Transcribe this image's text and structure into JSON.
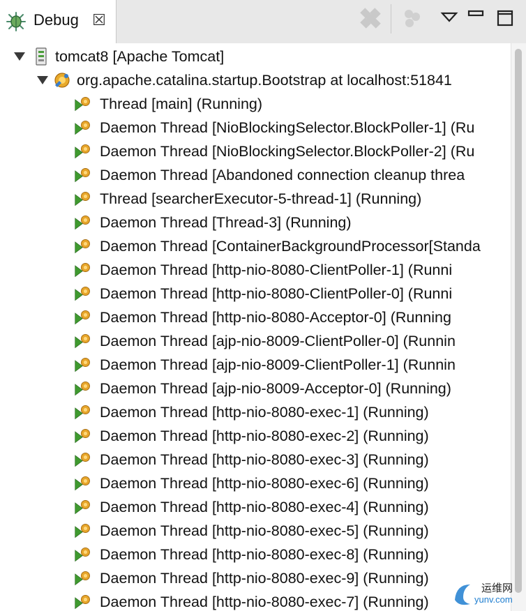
{
  "tab": {
    "label": "Debug",
    "close_glyph": "☒"
  },
  "toolbar": {
    "buttons": [
      {
        "name": "remove-all-terminated-icon"
      },
      {
        "name": "connect-icon"
      },
      {
        "name": "view-menu-icon"
      },
      {
        "name": "minimize-icon"
      },
      {
        "name": "maximize-icon"
      }
    ]
  },
  "tree": {
    "server": {
      "label": "tomcat8 [Apache Tomcat]",
      "icon": "server-icon"
    },
    "vm": {
      "label": "org.apache.catalina.startup.Bootstrap at localhost:51841",
      "icon": "debug-target-icon"
    },
    "threads": [
      "Thread [main] (Running)",
      "Daemon Thread [NioBlockingSelector.BlockPoller-1] (Ru",
      "Daemon Thread [NioBlockingSelector.BlockPoller-2] (Ru",
      "Daemon Thread [Abandoned connection cleanup threa",
      "Thread [searcherExecutor-5-thread-1] (Running)",
      "Daemon Thread [Thread-3] (Running)",
      "Daemon Thread [ContainerBackgroundProcessor[Standa",
      "Daemon Thread [http-nio-8080-ClientPoller-1] (Runni",
      "Daemon Thread [http-nio-8080-ClientPoller-0] (Runni",
      "Daemon Thread [http-nio-8080-Acceptor-0] (Running",
      "Daemon Thread [ajp-nio-8009-ClientPoller-0] (Runnin",
      "Daemon Thread [ajp-nio-8009-ClientPoller-1] (Runnin",
      "Daemon Thread [ajp-nio-8009-Acceptor-0] (Running)",
      "Daemon Thread [http-nio-8080-exec-1] (Running)",
      "Daemon Thread [http-nio-8080-exec-2] (Running)",
      "Daemon Thread [http-nio-8080-exec-3] (Running)",
      "Daemon Thread [http-nio-8080-exec-6] (Running)",
      "Daemon Thread [http-nio-8080-exec-4] (Running)",
      "Daemon Thread [http-nio-8080-exec-5] (Running)",
      "Daemon Thread [http-nio-8080-exec-8] (Running)",
      "Daemon Thread [http-nio-8080-exec-9] (Running)",
      "Daemon Thread [http-nio-8080-exec-7] (Running)"
    ]
  },
  "watermark": {
    "line1": "运维网",
    "line2": "yunv.com"
  }
}
